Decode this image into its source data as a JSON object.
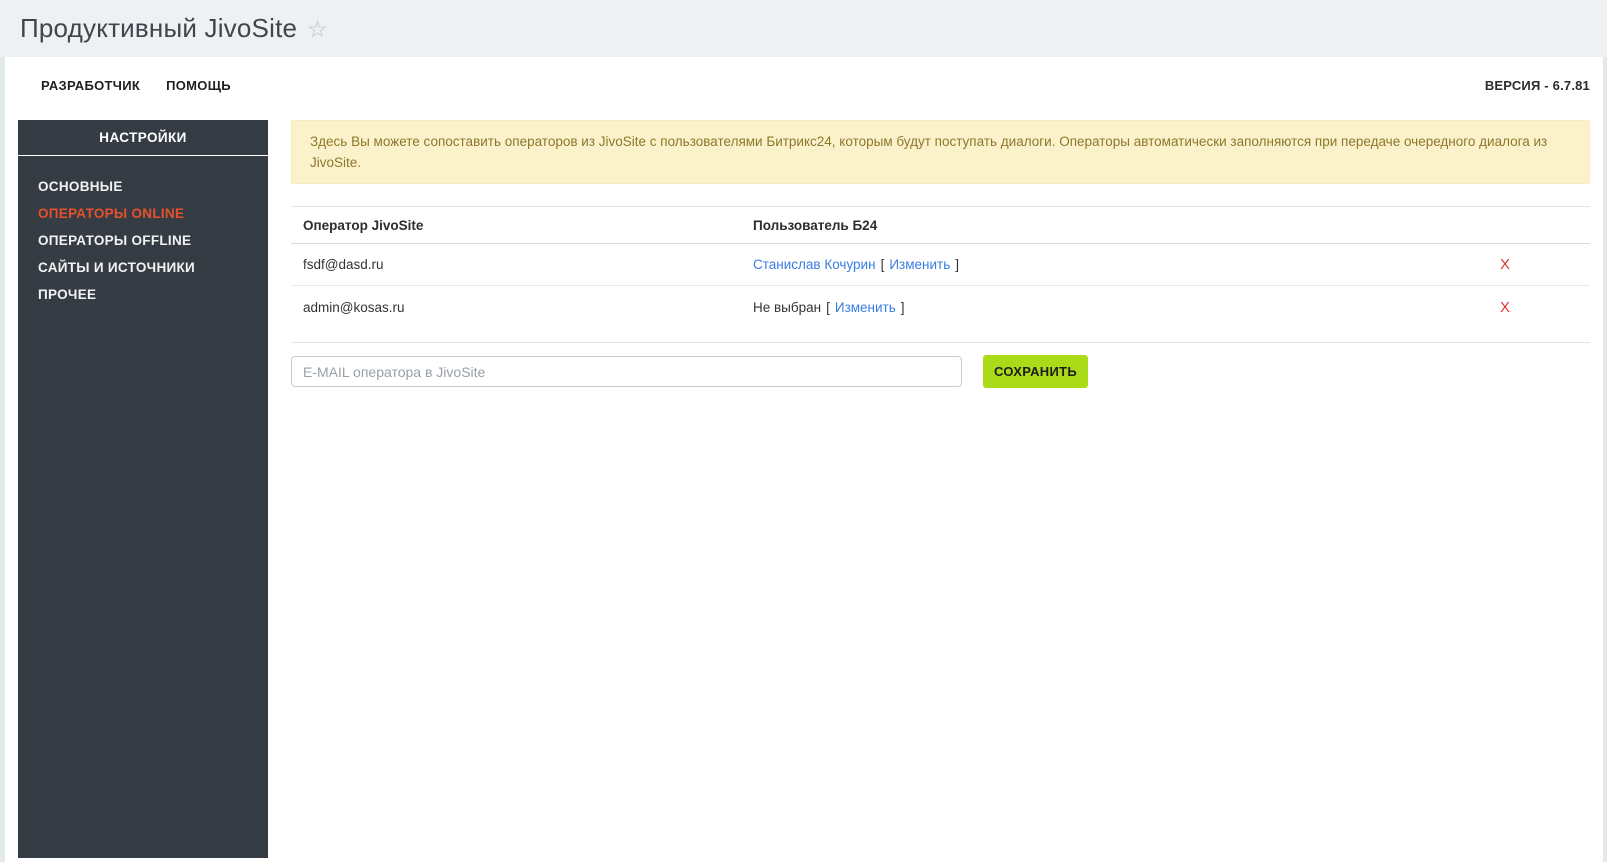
{
  "page": {
    "title": "Продуктивный JivoSite",
    "star_icon": "☆"
  },
  "topmenu": {
    "developer_label": "РАЗРАБОТЧИК",
    "help_label": "ПОМОЩЬ",
    "version_label": "ВЕРСИЯ - 6.7.81"
  },
  "sidebar": {
    "header": "НАСТРОЙКИ",
    "items": [
      {
        "label": "ОСНОВНЫЕ",
        "active": false
      },
      {
        "label": "ОПЕРАТОРЫ ONLINE",
        "active": true
      },
      {
        "label": "ОПЕРАТОРЫ OFFLINE",
        "active": false
      },
      {
        "label": "САЙТЫ И ИСТОЧНИКИ",
        "active": false
      },
      {
        "label": "ПРОЧЕЕ",
        "active": false
      }
    ]
  },
  "main": {
    "notice": "Здесь Вы можете сопоставить операторов из JivoSite с пользователями Битрикс24, которым будут поступать диалоги. Операторы автоматически заполняются при передаче очередного диалога из JivoSite.",
    "table": {
      "columns": [
        "Оператор JivoSite",
        "Пользователь Б24"
      ],
      "brackets": {
        "open": "[",
        "close": "]"
      },
      "rows": [
        {
          "operator_email": "fsdf@dasd.ru",
          "user_name": "Станислав Кочурин",
          "edit_label": "Изменить",
          "delete_label": "X"
        },
        {
          "operator_email": "admin@kosas.ru",
          "user_name": "Не выбран",
          "edit_label": "Изменить",
          "delete_label": "X"
        }
      ]
    },
    "form": {
      "email_placeholder": "E-MAIL оператора в JivoSite",
      "save_label": "СОХРАНИТЬ"
    }
  },
  "colors": {
    "topbar_bg": "#eef1f4",
    "sidebar_bg": "#363c44",
    "sidebar_active": "#e4512b",
    "notice_bg": "#fbf2cc",
    "notice_text": "#8d7829",
    "link_blue": "#3a7de0",
    "delete_red": "#e23333",
    "save_green": "#abdb18"
  }
}
